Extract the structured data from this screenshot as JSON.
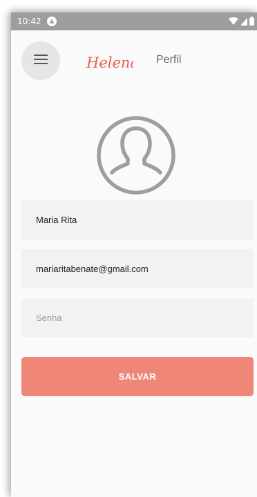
{
  "status_bar": {
    "time": "10:42",
    "icons": [
      "notification-icon",
      "wifi-icon",
      "signal-icon",
      "battery-icon"
    ]
  },
  "header": {
    "menu_icon": "hamburger-menu-icon",
    "logo_text": "Helena",
    "title": "Perfil"
  },
  "profile": {
    "avatar_icon": "user-avatar-icon"
  },
  "form": {
    "name_value": "Maria Rita",
    "email_value": "mariaritabenate@gmail.com",
    "password_placeholder": "Senha",
    "save_label": "SALVAR"
  },
  "colors": {
    "accent": "#ef8677",
    "logo": "#e8604f",
    "field_background": "#f2f2f2",
    "status_bar": "#9e9e9e",
    "icon_gray": "#9e9e9e"
  }
}
